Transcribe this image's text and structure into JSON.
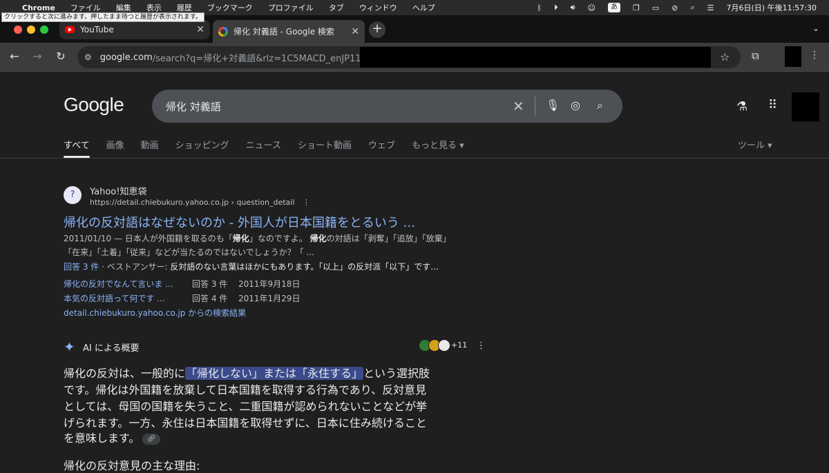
{
  "menubar": {
    "app": "Chrome",
    "items": [
      "ファイル",
      "編集",
      "表示",
      "履歴",
      "ブックマーク",
      "プロファイル",
      "タブ",
      "ウィンドウ",
      "ヘルプ"
    ],
    "ime": "あ",
    "clock": "7月6日(日) 午後11:57:30"
  },
  "tooltip": "クリックすると次に進みます。押したまま待つと履歴が表示されます。",
  "tabs": {
    "youtube": "YouTube",
    "google": "帰化 対義語 - Google 検索"
  },
  "omnibox": {
    "host": "google.com",
    "path": "/search?q=帰化+対義語&rlz=1C5MACD_enJP1156"
  },
  "google": {
    "logo": "Google",
    "query": "帰化 対義語",
    "tabs": [
      "すべて",
      "画像",
      "動画",
      "ショッピング",
      "ニュース",
      "ショート動画",
      "ウェブ",
      "もっと見る"
    ],
    "tools": "ツール"
  },
  "result": {
    "site_name": "Yahoo!知恵袋",
    "site_url": "https://detail.chiebukuro.yahoo.co.jp › question_detail",
    "title": "帰化の反対語はなぜないのか - 外国人が日本国籍をとるいう ...",
    "snippet_date": "2011/01/10 — 日本人が外国籍を取るのも「",
    "snippet_bold1": "帰化",
    "snippet_mid": "」なのですよ。",
    "snippet_bold2": "帰化",
    "snippet_rest": "の対語は「剥奪」「追放」「放棄」",
    "snippet_line2": "「在来」「土着」「従来」などが当たるのではないでしょうか？「 ...",
    "answers_link": "回答 3 件",
    "best_answer_label": " · ベストアンサー: ",
    "best_answer": "反対語のない言葉はほかにもあります。「以上」の反対派「以下」です…",
    "sub1_title": "帰化の反対でなんて言いま ...",
    "sub1_answers": "回答 3 件",
    "sub1_date": "2011年9月18日",
    "sub2_title": "本気の反対語って何です ...",
    "sub2_answers": "回答 4 件",
    "sub2_date": "2011年1月29日",
    "more_from": "detail.chiebukuro.yahoo.co.jp からの検索結果"
  },
  "ai": {
    "label": "AI による概要",
    "more_count": "+11",
    "line1_pre": "帰化の反対は、一般的に",
    "line1_hl": "「帰化しない」または「永住する」",
    "line1_post": "という選択肢",
    "line2": "です。帰化は外国籍を放棄して日本国籍を取得する行為であり、反対意見",
    "line3": "としては、母国の国籍を失うこと、二重国籍が認められないことなどが挙",
    "line4": "げられます。一方、永住は日本国籍を取得せずに、日本に住み続けること",
    "line5": "を意味します。",
    "line6": "帰化の反対意見の主な理由:"
  }
}
